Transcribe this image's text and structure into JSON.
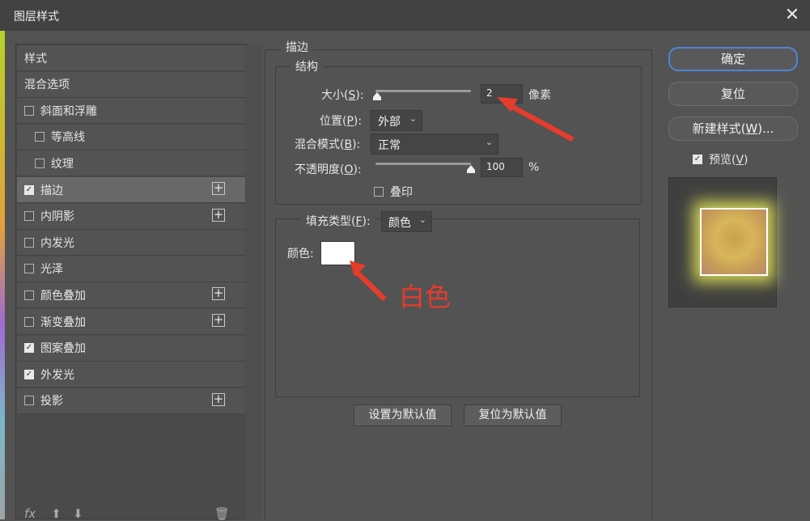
{
  "window": {
    "title": "图层样式"
  },
  "sidebar": {
    "items": [
      {
        "label": "样式",
        "type": "header",
        "checked": false,
        "plus": false
      },
      {
        "label": "混合选项",
        "type": "header",
        "checked": false,
        "plus": false
      },
      {
        "label": "斜面和浮雕",
        "type": "check",
        "checked": false,
        "plus": false
      },
      {
        "label": "等高线",
        "type": "sub",
        "checked": false,
        "plus": false
      },
      {
        "label": "纹理",
        "type": "sub",
        "checked": false,
        "plus": false
      },
      {
        "label": "描边",
        "type": "check",
        "checked": true,
        "plus": true,
        "active": true
      },
      {
        "label": "内阴影",
        "type": "check",
        "checked": false,
        "plus": true
      },
      {
        "label": "内发光",
        "type": "check",
        "checked": false,
        "plus": false
      },
      {
        "label": "光泽",
        "type": "check",
        "checked": false,
        "plus": false
      },
      {
        "label": "颜色叠加",
        "type": "check",
        "checked": false,
        "plus": true
      },
      {
        "label": "渐变叠加",
        "type": "check",
        "checked": false,
        "plus": true
      },
      {
        "label": "图案叠加",
        "type": "check",
        "checked": true,
        "plus": false
      },
      {
        "label": "外发光",
        "type": "check",
        "checked": true,
        "plus": false
      },
      {
        "label": "投影",
        "type": "check",
        "checked": false,
        "plus": true
      }
    ],
    "footer": "fx"
  },
  "stroke": {
    "section_title": "描边",
    "structure": {
      "title": "结构",
      "size": {
        "label_pre": "大小(",
        "key": "S",
        "label_post": "):",
        "value": "2",
        "unit": "像素",
        "slider_fraction": 0.02
      },
      "position": {
        "label_pre": "位置(",
        "key": "P",
        "label_post": "):",
        "value": "外部"
      },
      "blend": {
        "label_pre": "混合模式(",
        "key": "B",
        "label_post": "):",
        "value": "正常"
      },
      "opacity": {
        "label_pre": "不透明度(",
        "key": "O",
        "label_post": "):",
        "value": "100",
        "unit": "%",
        "slider_fraction": 1.0
      },
      "overprint": {
        "label": "叠印",
        "checked": false
      }
    },
    "fill": {
      "label_pre": "填充类型(",
      "key": "F",
      "label_post": "):",
      "value": "颜色",
      "color_label": "颜色:",
      "color": "#ffffff"
    },
    "defaults": {
      "set": "设置为默认值",
      "reset": "复位为默认值"
    }
  },
  "actions": {
    "ok": "确定",
    "reset": "复位",
    "new_style_pre": "新建样式(",
    "new_style_key": "W",
    "new_style_post": ")...",
    "preview_label_pre": "预览(",
    "preview_key": "V",
    "preview_label_post": ")",
    "preview_checked": true
  },
  "annotation": {
    "text": "白色",
    "color": "#e53c2c"
  }
}
